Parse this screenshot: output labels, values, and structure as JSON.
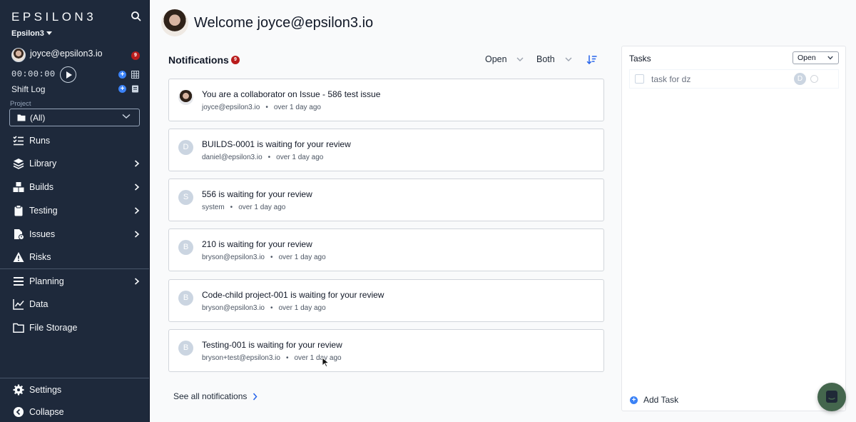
{
  "sidebar": {
    "logo": "EPSILON3",
    "workspace": "Epsilon3",
    "user_email": "joyce@epsilon3.io",
    "user_badge": "9",
    "timer": "00:00:00",
    "shift_log": "Shift Log",
    "project_label": "Project",
    "project_value": "(All)",
    "nav": [
      {
        "label": "Runs",
        "icon": "list-check-icon",
        "has_arrow": false
      },
      {
        "label": "Library",
        "icon": "layers-icon",
        "has_arrow": true
      },
      {
        "label": "Builds",
        "icon": "cubes-icon",
        "has_arrow": true
      },
      {
        "label": "Testing",
        "icon": "clipboard-icon",
        "has_arrow": true
      },
      {
        "label": "Issues",
        "icon": "file-alert-icon",
        "has_arrow": true
      },
      {
        "label": "Risks",
        "icon": "warning-icon",
        "has_arrow": false
      },
      {
        "label": "Planning",
        "icon": "bars-icon",
        "has_arrow": true
      },
      {
        "label": "Data",
        "icon": "line-chart-icon",
        "has_arrow": false
      },
      {
        "label": "File Storage",
        "icon": "folder-icon",
        "has_arrow": false
      }
    ],
    "settings": "Settings",
    "collapse": "Collapse"
  },
  "main": {
    "welcome": "Welcome joyce@epsilon3.io",
    "notifications_title": "Notifications",
    "notifications_badge": "9",
    "filter_status": "Open",
    "filter_type": "Both",
    "notifications": [
      {
        "avatar": "",
        "title": "You are a collaborator on Issue - 586 test issue",
        "sender": "joyce@epsilon3.io",
        "time": "over 1 day ago"
      },
      {
        "avatar": "D",
        "title": "BUILDS-0001 is waiting for your review",
        "sender": "daniel@epsilon3.io",
        "time": "over 1 day ago"
      },
      {
        "avatar": "S",
        "title": "556 is waiting for your review",
        "sender": "system",
        "time": "over 1 day ago"
      },
      {
        "avatar": "B",
        "title": "210 is waiting for your review",
        "sender": "bryson@epsilon3.io",
        "time": "over 1 day ago"
      },
      {
        "avatar": "B",
        "title": "Code-child project-001 is waiting for your review",
        "sender": "bryson@epsilon3.io",
        "time": "over 1 day ago"
      },
      {
        "avatar": "B",
        "title": "Testing-001 is waiting for your review",
        "sender": "bryson+test@epsilon3.io",
        "time": "over 1 day ago"
      }
    ],
    "see_all": "See all notifications"
  },
  "tasks": {
    "title": "Tasks",
    "filter": "Open",
    "items": [
      {
        "label": "task for dz",
        "assignee": "D"
      }
    ],
    "add_label": "Add Task"
  },
  "colors": {
    "sidebar_bg": "#1e293b",
    "accent": "#3b82f6",
    "badge": "#b91c1c",
    "chat": "#44664d"
  }
}
